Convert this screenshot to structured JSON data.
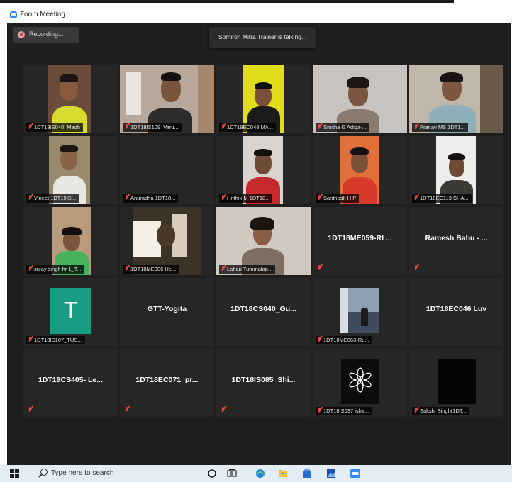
{
  "window": {
    "title": "Zoom Meeting"
  },
  "recording": {
    "label": "Recording..."
  },
  "speaker_banner": {
    "text": "Somiron Mitra Trainer is talking..."
  },
  "participants": [
    {
      "name": "1DT18IS040_Madh",
      "muted": true,
      "video": true
    },
    {
      "name": "1DT18IS109_Varu...",
      "muted": true,
      "video": true
    },
    {
      "name": "1DT18EC048 MA...",
      "muted": true,
      "video": true
    },
    {
      "name": "Smitha G Adiga-...",
      "muted": true,
      "video": true
    },
    {
      "name": "Pranav MS 1DT1...",
      "muted": true,
      "video": true
    },
    {
      "name": "Vineet 1DT19IS...",
      "muted": true,
      "video": true
    },
    {
      "name": "Anuradha 1DT18...",
      "muted": true,
      "video": false
    },
    {
      "name": "Hrithik M 1DT18...",
      "muted": true,
      "video": true
    },
    {
      "name": "Santhosh H P",
      "muted": true,
      "video": true
    },
    {
      "name": "1DT18EC113 SHA...",
      "muted": true,
      "video": true
    },
    {
      "name": "sujay singh hr 1_T...",
      "muted": true,
      "video": true
    },
    {
      "name": "1DT18ME006 He...",
      "muted": true,
      "video": true
    },
    {
      "name": "Lahari Tummalap...",
      "muted": true,
      "video": true
    },
    {
      "name": "1DT18ME059-RI ...",
      "muted": true,
      "video": false
    },
    {
      "name": "Ramesh Babu - ...",
      "muted": true,
      "video": false
    },
    {
      "name": "1DT18IS107_TUS...",
      "avatar_letter": "T",
      "muted": true,
      "video": false
    },
    {
      "name": "GTT-Yogita",
      "muted": false,
      "video": false
    },
    {
      "name": "1DT18CS040_Gu...",
      "muted": false,
      "video": false
    },
    {
      "name": "1DT18ME063-Ru...",
      "muted": true,
      "video": true
    },
    {
      "name": "1DT18EC046 Luv",
      "muted": false,
      "video": false
    },
    {
      "name": "1DT19CS405- Le...",
      "muted": true,
      "video": false
    },
    {
      "name": "1DT18EC071_pr...",
      "muted": true,
      "video": false
    },
    {
      "name": "1DT18IS085_Shi...",
      "muted": true,
      "video": false
    },
    {
      "name": "1DT18IS037 isha...",
      "muted": true,
      "video": true
    },
    {
      "name": "Sakshi Singh(1DT...",
      "muted": true,
      "video": true
    }
  ],
  "taskbar": {
    "search_placeholder": "Type here to search",
    "icons": [
      "start-icon",
      "search-icon",
      "cortana-icon",
      "task-view-icon",
      "edge-icon",
      "file-explorer-icon",
      "store-icon",
      "photos-icon",
      "zoom-icon"
    ]
  },
  "colors": {
    "meeting_bg": "#1f1f1f",
    "tile_bg": "#262626",
    "muted_icon": "#e04848",
    "zoom_blue": "#2d8cff",
    "avatar_green": "#189c83",
    "taskbar_bg": "#e4ecf6"
  }
}
